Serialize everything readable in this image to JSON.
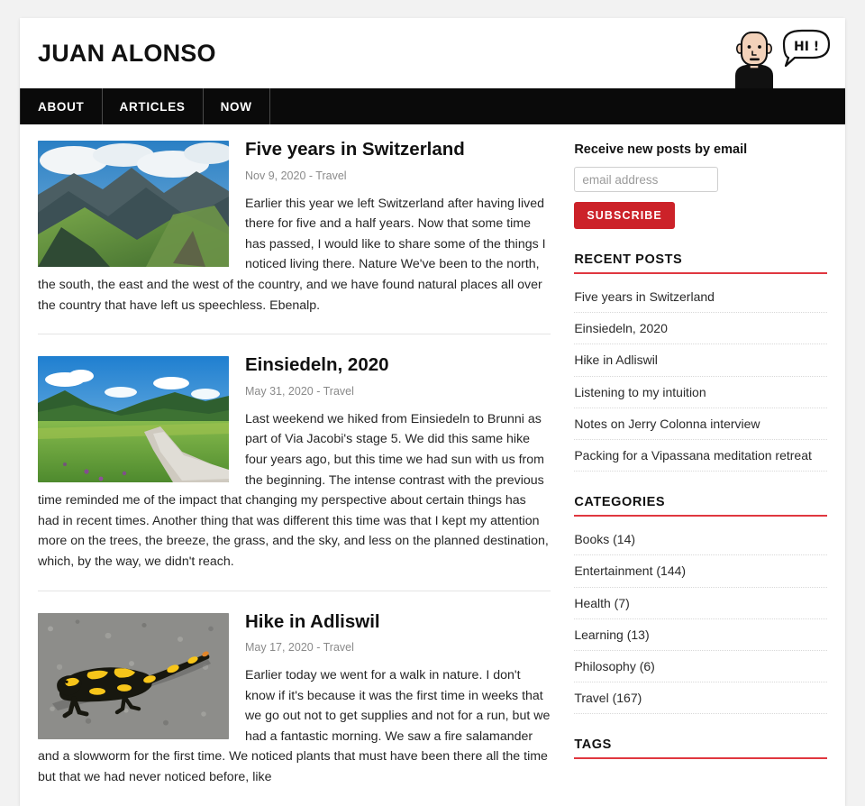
{
  "site": {
    "title": "JUAN ALONSO",
    "avatar_icon": "cartoon-avatar-icon",
    "speech_bubble_text": "HI !"
  },
  "nav": {
    "items": [
      {
        "label": "ABOUT"
      },
      {
        "label": "ARTICLES"
      },
      {
        "label": "NOW"
      }
    ]
  },
  "articles": [
    {
      "title": "Five years in Switzerland",
      "date": "Nov 9, 2020",
      "category": "Travel",
      "meta": "Nov 9, 2020 - Travel",
      "thumb_icon": "mountain-valley-photo",
      "excerpt": "Earlier this year we left Switzerland after having lived there for five and a half years. Now that some time has passed, I would like to share some of the things I noticed living there. Nature We've been to the north, the south, the east and the west of the country, and we have found natural places all over the country that have left us speechless. Ebenalp."
    },
    {
      "title": "Einsiedeln, 2020",
      "date": "May 31, 2020",
      "category": "Travel",
      "meta": "May 31, 2020 - Travel",
      "thumb_icon": "meadow-path-photo",
      "excerpt": "Last weekend we hiked from Einsiedeln to Brunni as part of Via Jacobi's stage 5. We did this same hike four years ago, but this time we had sun with us from the beginning. The intense contrast with the previous time reminded me of the impact that changing my perspective about certain things has had in recent times. Another thing that was different this time was that I kept my attention more on the trees, the breeze, the grass, and the sky, and less on the planned destination, which, by the way, we didn't reach."
    },
    {
      "title": "Hike in Adliswil",
      "date": "May 17, 2020",
      "category": "Travel",
      "meta": "May 17, 2020 - Travel",
      "thumb_icon": "fire-salamander-photo",
      "excerpt": "Earlier today we went for a walk in nature. I don't know if it's because it was the first time in weeks that we go out not to get supplies and not for a run, but we had a fantastic morning. We saw a fire salamander and a slowworm for the first time. We noticed plants that must have been there all the time but that we had never noticed before, like"
    }
  ],
  "sidebar": {
    "subscribe": {
      "title": "Receive new posts by email",
      "input_placeholder": "email address",
      "input_value": "",
      "button_label": "SUBSCRIBE"
    },
    "recent_posts": {
      "heading": "RECENT POSTS",
      "items": [
        {
          "label": "Five years in Switzerland"
        },
        {
          "label": "Einsiedeln, 2020"
        },
        {
          "label": "Hike in Adliswil"
        },
        {
          "label": "Listening to my intuition"
        },
        {
          "label": "Notes on Jerry Colonna interview"
        },
        {
          "label": "Packing for a Vipassana meditation retreat"
        }
      ]
    },
    "categories": {
      "heading": "CATEGORIES",
      "items": [
        {
          "label": "Books (14)"
        },
        {
          "label": "Entertainment (144)"
        },
        {
          "label": "Health (7)"
        },
        {
          "label": "Learning (13)"
        },
        {
          "label": "Philosophy (6)"
        },
        {
          "label": "Travel (167)"
        }
      ]
    },
    "tags": {
      "heading": "TAGS"
    }
  },
  "colors": {
    "accent_red": "#e0373f",
    "button_red": "#cc2229",
    "nav_black": "#0a0a0a",
    "page_background": "#f2f2f2"
  }
}
